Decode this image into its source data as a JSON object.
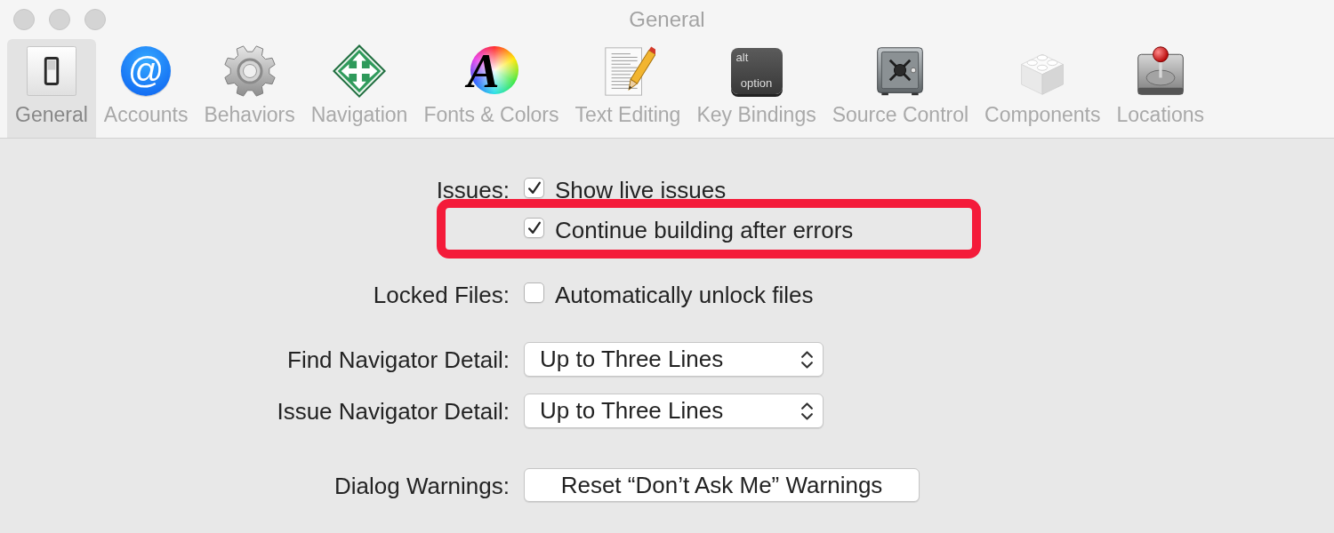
{
  "window": {
    "title": "General"
  },
  "toolbar": {
    "items": [
      {
        "label": "General",
        "selected": true
      },
      {
        "label": "Accounts",
        "selected": false,
        "glyph": "@"
      },
      {
        "label": "Behaviors",
        "selected": false
      },
      {
        "label": "Navigation",
        "selected": false
      },
      {
        "label": "Fonts & Colors",
        "selected": false,
        "glyph": "A"
      },
      {
        "label": "Text Editing",
        "selected": false
      },
      {
        "label": "Key Bindings",
        "selected": false,
        "key_labels": [
          "alt",
          "option"
        ]
      },
      {
        "label": "Source Control",
        "selected": false
      },
      {
        "label": "Components",
        "selected": false
      },
      {
        "label": "Locations",
        "selected": false
      }
    ]
  },
  "settings": [
    {
      "label": "Issues:",
      "kind": "checkboxes",
      "options": [
        {
          "label": "Show live issues",
          "checked": true,
          "highlighted": false
        },
        {
          "label": "Continue building after errors",
          "checked": true,
          "highlighted": true
        }
      ]
    },
    {
      "label": "Locked Files:",
      "kind": "checkboxes",
      "options": [
        {
          "label": "Automatically unlock files",
          "checked": false,
          "highlighted": false
        }
      ]
    },
    {
      "label": "Find Navigator Detail:",
      "kind": "popup",
      "value": "Up to Three Lines"
    },
    {
      "label": "Issue Navigator Detail:",
      "kind": "popup",
      "value": "Up to Three Lines"
    },
    {
      "label": "Dialog Warnings:",
      "kind": "button",
      "text": "Reset “Don’t Ask Me” Warnings"
    }
  ]
}
